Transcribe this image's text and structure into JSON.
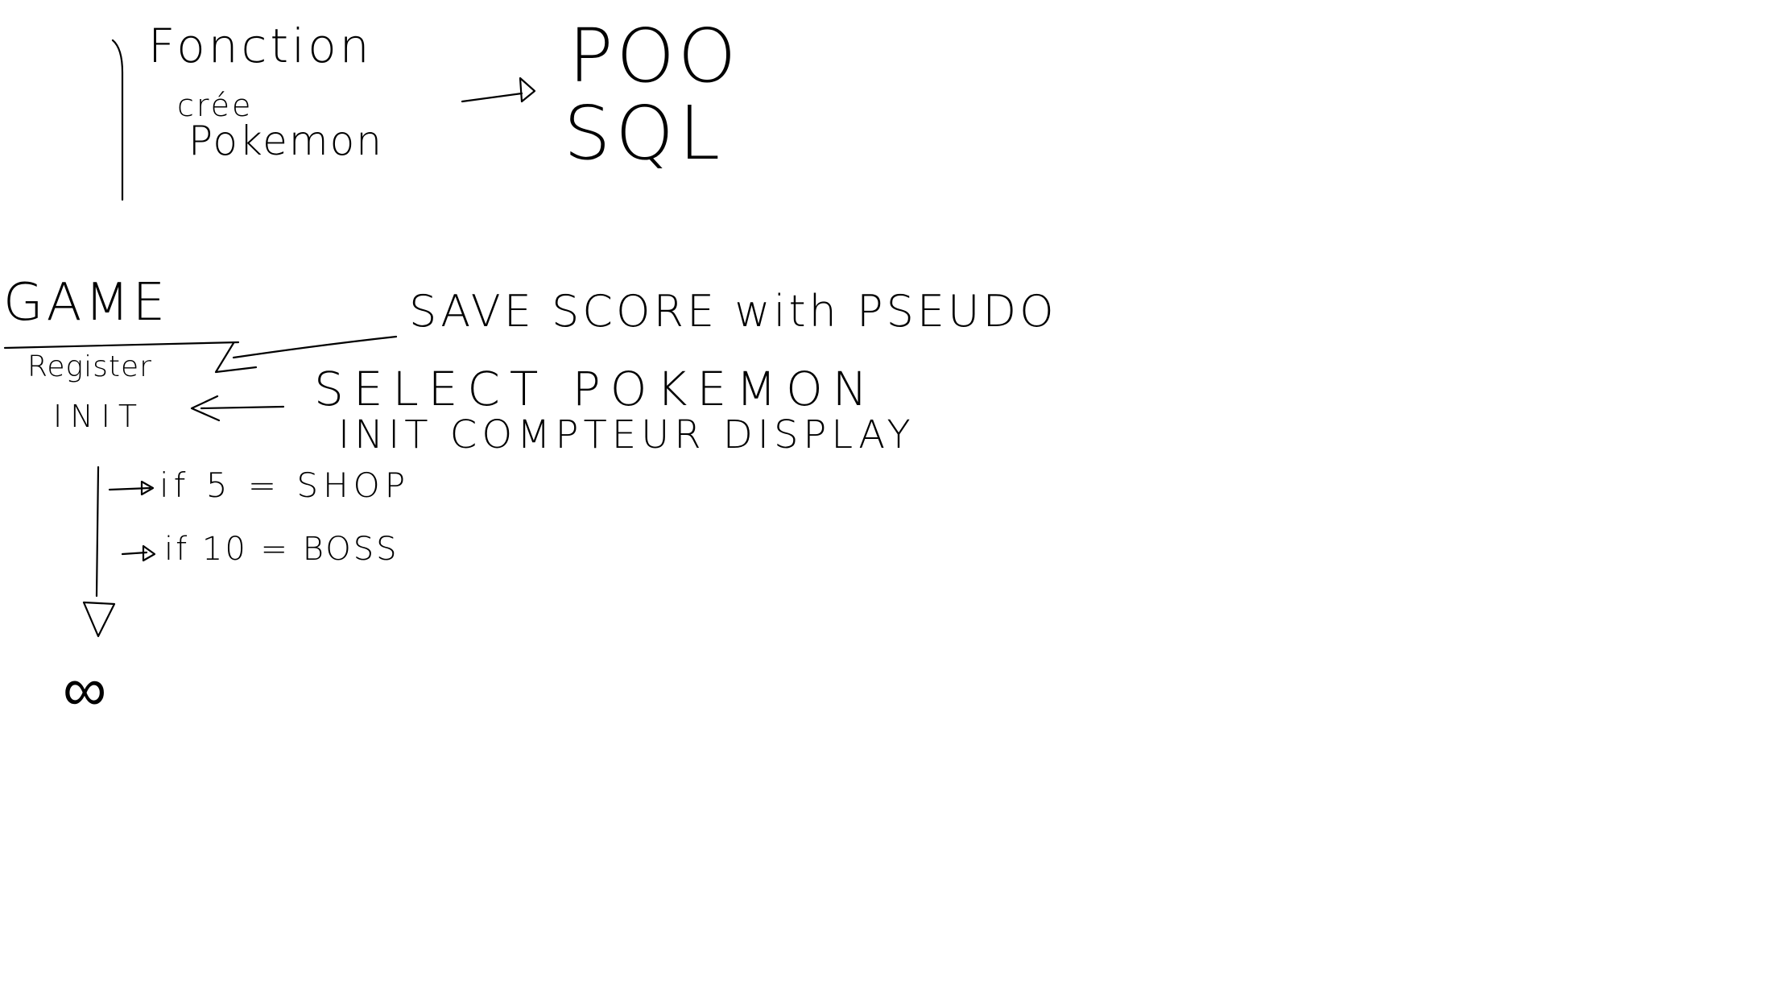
{
  "sketch": {
    "top": {
      "fonction_line1": "Fonction",
      "fonction_line2": "crée",
      "fonction_line3": "Pokemon",
      "poo": "POO",
      "sql": "SQL"
    },
    "game": {
      "title": "GAME",
      "register": "Register",
      "init": "INIT",
      "save_score": "SAVE SCORE with PSEUDO",
      "select_pokemon": "SELECT POKEMON",
      "init_compteur": "INIT COMPTEUR DISPLAY",
      "if5": "if 5 = SHOP",
      "if10": "if 10 = BOSS",
      "infinity": "∞"
    },
    "ink_color": "#000000",
    "background": "#ffffff"
  }
}
